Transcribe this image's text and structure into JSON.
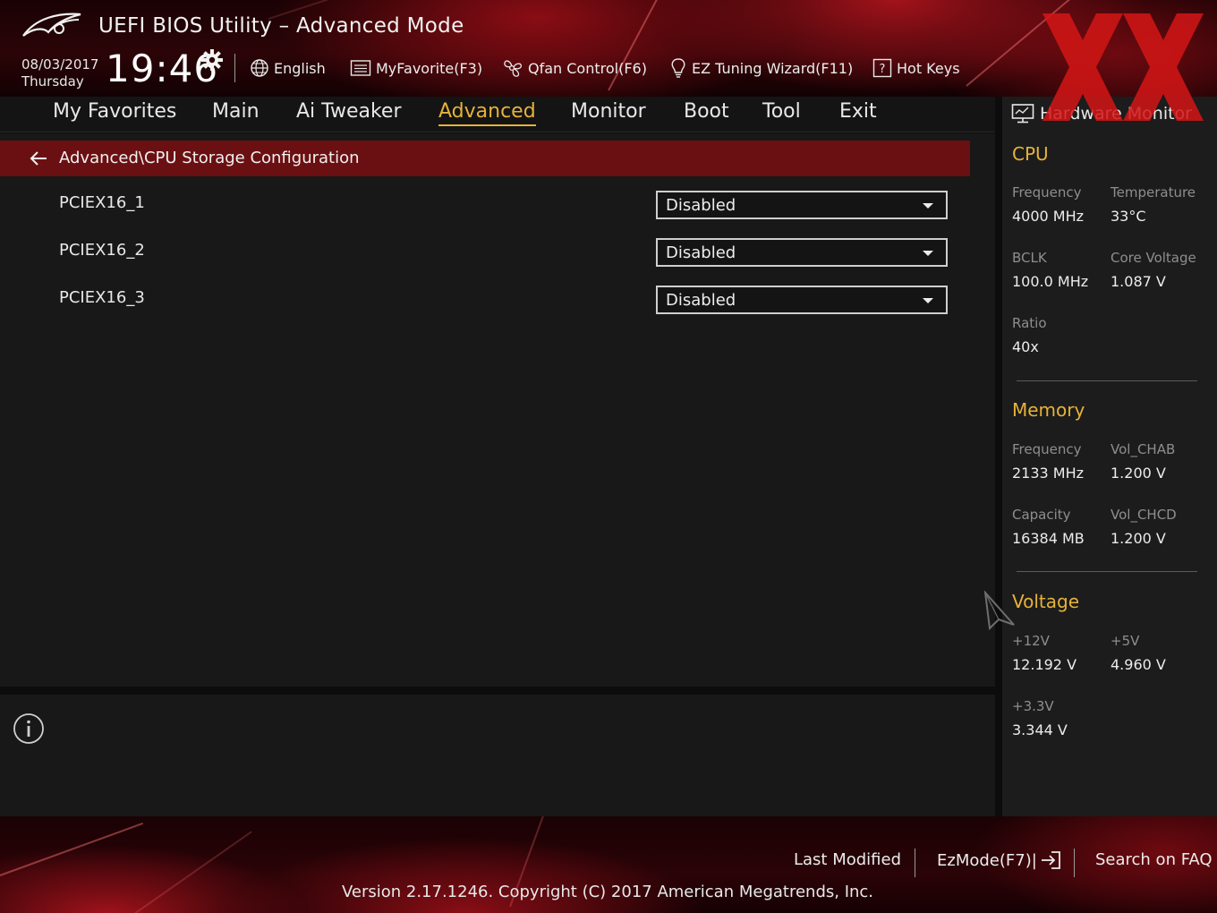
{
  "header": {
    "title": "UEFI BIOS Utility – Advanced Mode",
    "date": "08/03/2017",
    "day": "Thursday",
    "time": "19:46",
    "buttons": {
      "language": "English",
      "favorite": "MyFavorite(F3)",
      "qfan": "Qfan Control(F6)",
      "ez_tuning": "EZ Tuning Wizard(F11)",
      "hotkeys": "Hot Keys"
    },
    "icons": [
      "rog-logo",
      "gear-icon",
      "globe-icon",
      "favorite-list-icon",
      "fan-icon",
      "lightbulb-icon",
      "help-key-icon"
    ]
  },
  "nav": {
    "tabs": [
      {
        "label": "My Favorites"
      },
      {
        "label": "Main"
      },
      {
        "label": "Ai Tweaker"
      },
      {
        "label": "Advanced",
        "active": true
      },
      {
        "label": "Monitor"
      },
      {
        "label": "Boot"
      },
      {
        "label": "Tool"
      },
      {
        "label": "Exit"
      }
    ]
  },
  "breadcrumb": "Advanced\\CPU Storage Configuration",
  "settings": [
    {
      "label": "PCIEX16_1",
      "value": "Disabled"
    },
    {
      "label": "PCIEX16_2",
      "value": "Disabled"
    },
    {
      "label": "PCIEX16_3",
      "value": "Disabled"
    }
  ],
  "hardware_monitor": {
    "title": "Hardware Monitor",
    "cpu": {
      "title": "CPU",
      "frequency_label": "Frequency",
      "frequency": "4000 MHz",
      "temperature_label": "Temperature",
      "temperature": "33°C",
      "bclk_label": "BCLK",
      "bclk": "100.0 MHz",
      "core_voltage_label": "Core Voltage",
      "core_voltage": "1.087 V",
      "ratio_label": "Ratio",
      "ratio": "40x"
    },
    "memory": {
      "title": "Memory",
      "frequency_label": "Frequency",
      "frequency": "2133 MHz",
      "vol_chab_label": "Vol_CHAB",
      "vol_chab": "1.200 V",
      "capacity_label": "Capacity",
      "capacity": "16384 MB",
      "vol_chcd_label": "Vol_CHCD",
      "vol_chcd": "1.200 V"
    },
    "voltage": {
      "title": "Voltage",
      "v12_label": "+12V",
      "v12": "12.192 V",
      "v5_label": "+5V",
      "v5": "4.960 V",
      "v33_label": "+3.3V",
      "v33": "3.344 V"
    }
  },
  "footer": {
    "last_modified": "Last Modified",
    "ezmode": "EzMode(F7)|",
    "search_faq": "Search on FAQ",
    "version": "Version 2.17.1246. Copyright (C) 2017 American Megatrends, Inc."
  },
  "colors": {
    "accent": "#e6b23a",
    "breadcrumb_bg": "#6b1012",
    "panel_bg": "#181818",
    "brand_red": "#a3121b"
  }
}
